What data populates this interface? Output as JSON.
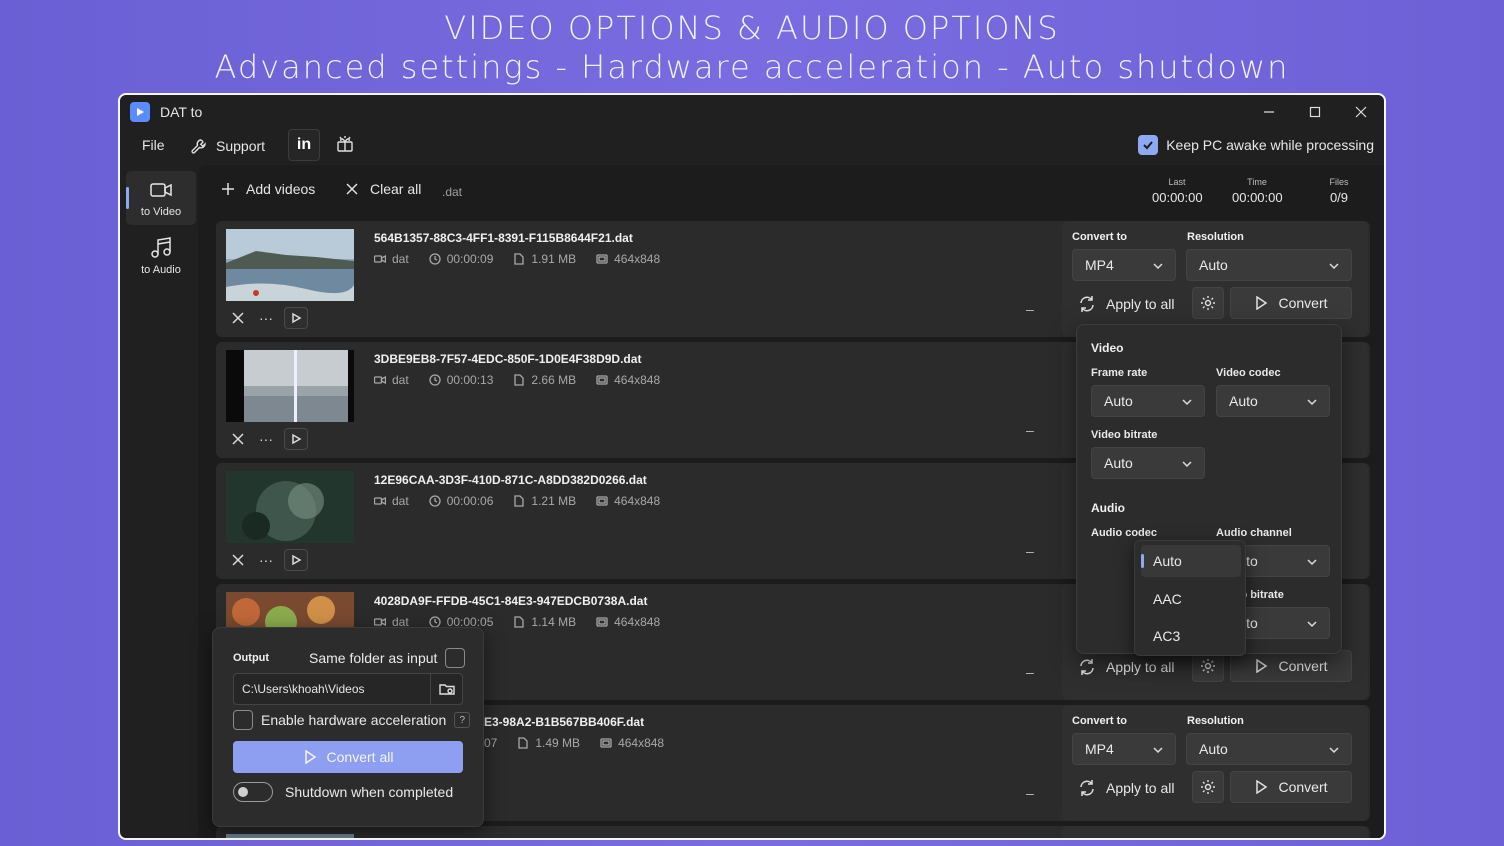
{
  "banner": {
    "line1": "VIDEO OPTIONS & AUDIO OPTIONS",
    "line2": "Advanced settings - Hardware acceleration - Auto shutdown"
  },
  "window": {
    "title": "DAT to"
  },
  "menu": {
    "file": "File",
    "support": "Support",
    "linkedin": "in",
    "keep_awake": "Keep PC awake while processing",
    "keep_awake_checked": true
  },
  "sidebar": [
    {
      "label": "to Video",
      "icon": "video-camera-icon",
      "selected": true
    },
    {
      "label": "to Audio",
      "icon": "music-note-icon",
      "selected": false
    }
  ],
  "toolbar": {
    "add_videos": "Add videos",
    "clear_all": "Clear all",
    "ext": ".dat",
    "stats": [
      {
        "key": "Last",
        "value": "00:00:00"
      },
      {
        "key": "Time",
        "value": "00:00:00"
      },
      {
        "key": "Files",
        "value": "0/9"
      }
    ]
  },
  "files": [
    {
      "name": "564B1357-88C3-4FF1-8391-F115B8644F21.dat",
      "format": "dat",
      "duration": "00:00:09",
      "size": "1.91 MB",
      "resolution": "464x848"
    },
    {
      "name": "3DBE9EB8-7F57-4EDC-850F-1D0E4F38D9D.dat",
      "format": "dat",
      "duration": "00:00:13",
      "size": "2.66 MB",
      "resolution": "464x848"
    },
    {
      "name": "12E96CAA-3D3F-410D-871C-A8DD382D0266.dat",
      "format": "dat",
      "duration": "00:00:06",
      "size": "1.21 MB",
      "resolution": "464x848"
    },
    {
      "name": "4028DA9F-FFDB-45C1-84E3-947EDCB0738A.dat",
      "format": "dat",
      "duration": "00:00:05",
      "size": "1.14 MB",
      "resolution": "464x848"
    },
    {
      "name": "E3-98A2-B1B567BB406F.dat",
      "duration": "07",
      "size": "1.49 MB",
      "resolution": "464x848"
    }
  ],
  "convert_panel": {
    "convert_to_label": "Convert to",
    "resolution_label": "Resolution",
    "format": "MP4",
    "resolution": "Auto",
    "apply_to_all": "Apply to all",
    "convert": "Convert"
  },
  "row_dash": "–",
  "advanced": {
    "video_heading": "Video",
    "frame_rate_label": "Frame rate",
    "frame_rate": "Auto",
    "video_codec_label": "Video codec",
    "video_codec": "Auto",
    "video_bitrate_label": "Video bitrate",
    "video_bitrate": "Auto",
    "audio_heading": "Audio",
    "audio_codec_label": "Audio codec",
    "audio_channel_label": "Audio channel",
    "audio_channel": "Auto",
    "audio_bitrate_label": "Audio bitrate",
    "audio_bitrate": "Auto",
    "audio_codec_options": [
      "Auto",
      "AAC",
      "AC3"
    ],
    "audio_codec_selected": "Auto"
  },
  "output": {
    "heading": "Output",
    "same_folder": "Same folder as input",
    "path": "C:\\Users\\khoah\\Videos",
    "hw_accel": "Enable hardware acceleration",
    "hw_help": "?",
    "convert_all": "Convert all",
    "shutdown": "Shutdown when completed"
  },
  "colors": {
    "accent": "#8fa8f2",
    "background": "#6a5fd4",
    "convert_all_button": "#8e9ef0"
  }
}
